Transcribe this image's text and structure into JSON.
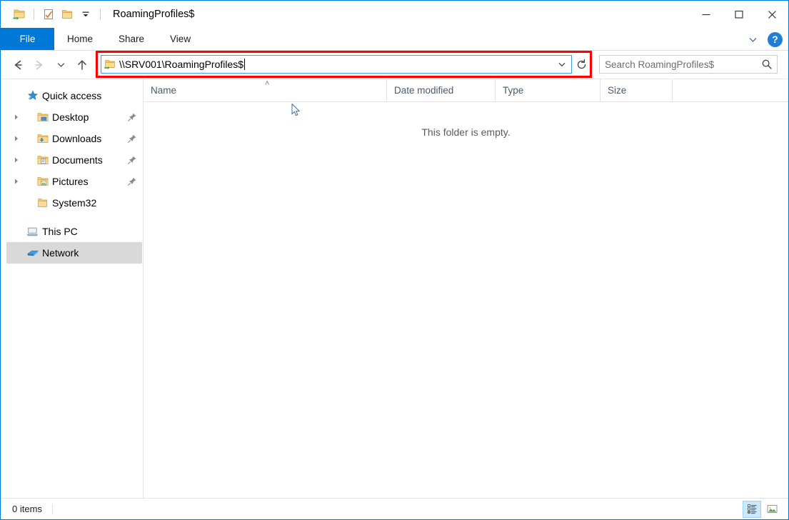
{
  "window": {
    "title": "RoamingProfiles$",
    "controls": {
      "minimize": "Minimize",
      "maximize": "Maximize",
      "close": "Close"
    },
    "quick_access_toolbar": [
      {
        "name": "network-folder-icon",
        "label": "Network Folder"
      },
      {
        "name": "properties-icon",
        "label": "Properties"
      },
      {
        "name": "new-folder-icon",
        "label": "New folder"
      },
      {
        "name": "customize-dropdown-icon",
        "label": "Customize Quick Access Toolbar"
      }
    ]
  },
  "ribbon": {
    "tabs": [
      {
        "label": "File",
        "active": true
      },
      {
        "label": "Home",
        "active": false
      },
      {
        "label": "Share",
        "active": false
      },
      {
        "label": "View",
        "active": false
      }
    ],
    "expand_label": "Expand the Ribbon",
    "help_label": "?"
  },
  "navigation": {
    "back_label": "Back",
    "forward_label": "Forward",
    "recent_label": "Recent locations",
    "up_label": "Up one level",
    "refresh_label": "Refresh"
  },
  "address_bar": {
    "value": "\\\\SRV001\\RoamingProfiles$",
    "placeholder": "",
    "icon": "network-folder-icon",
    "dropdown_label": "Previous locations",
    "highlighted": true,
    "highlight_color": "#ff0000"
  },
  "search": {
    "placeholder": "Search RoamingProfiles$",
    "value": "",
    "icon": "search-icon"
  },
  "sidebar": {
    "items": [
      {
        "label": "Quick access",
        "icon": "star-pin-icon",
        "level": 0,
        "pinned": false,
        "selected": false,
        "expander": false
      },
      {
        "label": "Desktop",
        "icon": "desktop-folder-icon",
        "level": 1,
        "pinned": true,
        "selected": false,
        "expander": true
      },
      {
        "label": "Downloads",
        "icon": "downloads-folder-icon",
        "level": 1,
        "pinned": true,
        "selected": false,
        "expander": true
      },
      {
        "label": "Documents",
        "icon": "documents-folder-icon",
        "level": 1,
        "pinned": true,
        "selected": false,
        "expander": true
      },
      {
        "label": "Pictures",
        "icon": "pictures-folder-icon",
        "level": 1,
        "pinned": true,
        "selected": false,
        "expander": true
      },
      {
        "label": "System32",
        "icon": "folder-icon",
        "level": 1,
        "pinned": false,
        "selected": false,
        "expander": false
      },
      {
        "label": "This PC",
        "icon": "this-pc-icon",
        "level": 0,
        "pinned": false,
        "selected": false,
        "expander": false
      },
      {
        "label": "Network",
        "icon": "network-icon",
        "level": 0,
        "pinned": false,
        "selected": true,
        "expander": false
      }
    ]
  },
  "file_list": {
    "columns": [
      {
        "label": "Name",
        "sorted": true,
        "sort_direction": "asc"
      },
      {
        "label": "Date modified",
        "sorted": false
      },
      {
        "label": "Type",
        "sorted": false
      },
      {
        "label": "Size",
        "sorted": false
      }
    ],
    "sort_glyph": "˄",
    "rows": [],
    "empty_message": "This folder is empty."
  },
  "status_bar": {
    "item_count_text": "0 items",
    "views": [
      {
        "name": "details-view",
        "label": "Details view",
        "active": true
      },
      {
        "name": "large-icons-view",
        "label": "Large icons view",
        "active": false
      }
    ]
  }
}
